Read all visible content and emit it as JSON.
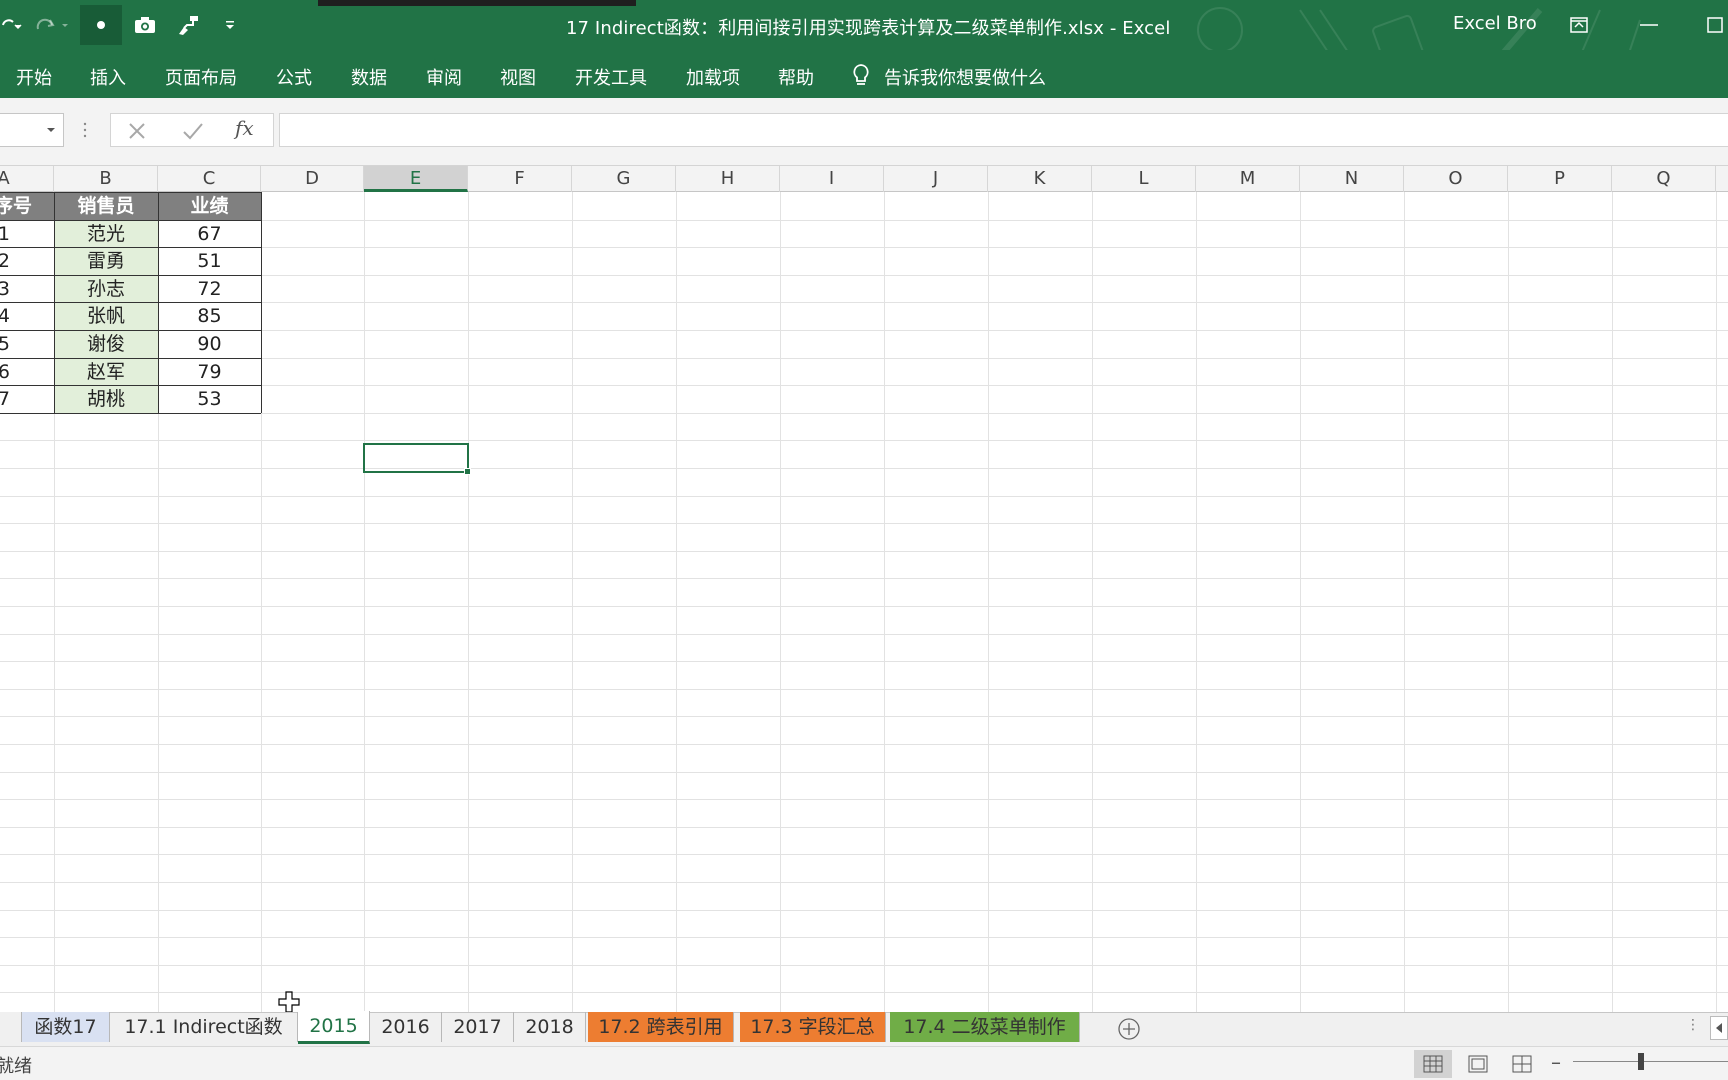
{
  "title_bar": {
    "document_title": "17 Indirect函数：利用间接引用实现跨表计算及二级菜单制作.xlsx  -  Excel",
    "user": "Excel Bro",
    "brand_color": "#217346"
  },
  "quick_access": [
    {
      "name": "undo-icon"
    },
    {
      "name": "redo-icon"
    },
    {
      "name": "record-icon"
    },
    {
      "name": "camera-icon"
    },
    {
      "name": "format-painter-icon"
    },
    {
      "name": "customize-icon"
    }
  ],
  "ribbon": {
    "tabs": [
      "开始",
      "插入",
      "页面布局",
      "公式",
      "数据",
      "审阅",
      "视图",
      "开发工具",
      "加载项",
      "帮助"
    ],
    "tell_me": "告诉我你想要做什么"
  },
  "formula_bar": {
    "name_box": "",
    "fx_label": "fx",
    "formula": ""
  },
  "columns": [
    "A",
    "B",
    "C",
    "D",
    "E",
    "F",
    "G",
    "H",
    "I",
    "J",
    "K",
    "L",
    "M",
    "N",
    "O",
    "P",
    "Q"
  ],
  "active_cell": {
    "column": "E",
    "row": 10
  },
  "table": {
    "headers": [
      "序号",
      "销售员",
      "业绩"
    ],
    "rows": [
      [
        "1",
        "范光",
        "67"
      ],
      [
        "2",
        "雷勇",
        "51"
      ],
      [
        "3",
        "孙志",
        "72"
      ],
      [
        "4",
        "张帆",
        "85"
      ],
      [
        "5",
        "谢俊",
        "90"
      ],
      [
        "6",
        "赵军",
        "79"
      ],
      [
        "7",
        "胡桃",
        "53"
      ]
    ],
    "header_color": "#808080",
    "name_fill": "#e2efda"
  },
  "sheet_tabs": [
    {
      "label": "函数17",
      "color": "#d9e1f2"
    },
    {
      "label": "17.1 Indirect函数",
      "color": ""
    },
    {
      "label": "2015",
      "color": "",
      "active": true
    },
    {
      "label": "2016",
      "color": ""
    },
    {
      "label": "2017",
      "color": ""
    },
    {
      "label": "2018",
      "color": ""
    },
    {
      "label": "17.2 跨表引用",
      "color": "#ed7d31"
    },
    {
      "label": "17.3 字段汇总",
      "color": "#ed7d31"
    },
    {
      "label": "17.4 二级菜单制作",
      "color": "#70ad47"
    }
  ],
  "status_bar": {
    "status": "就绪"
  }
}
